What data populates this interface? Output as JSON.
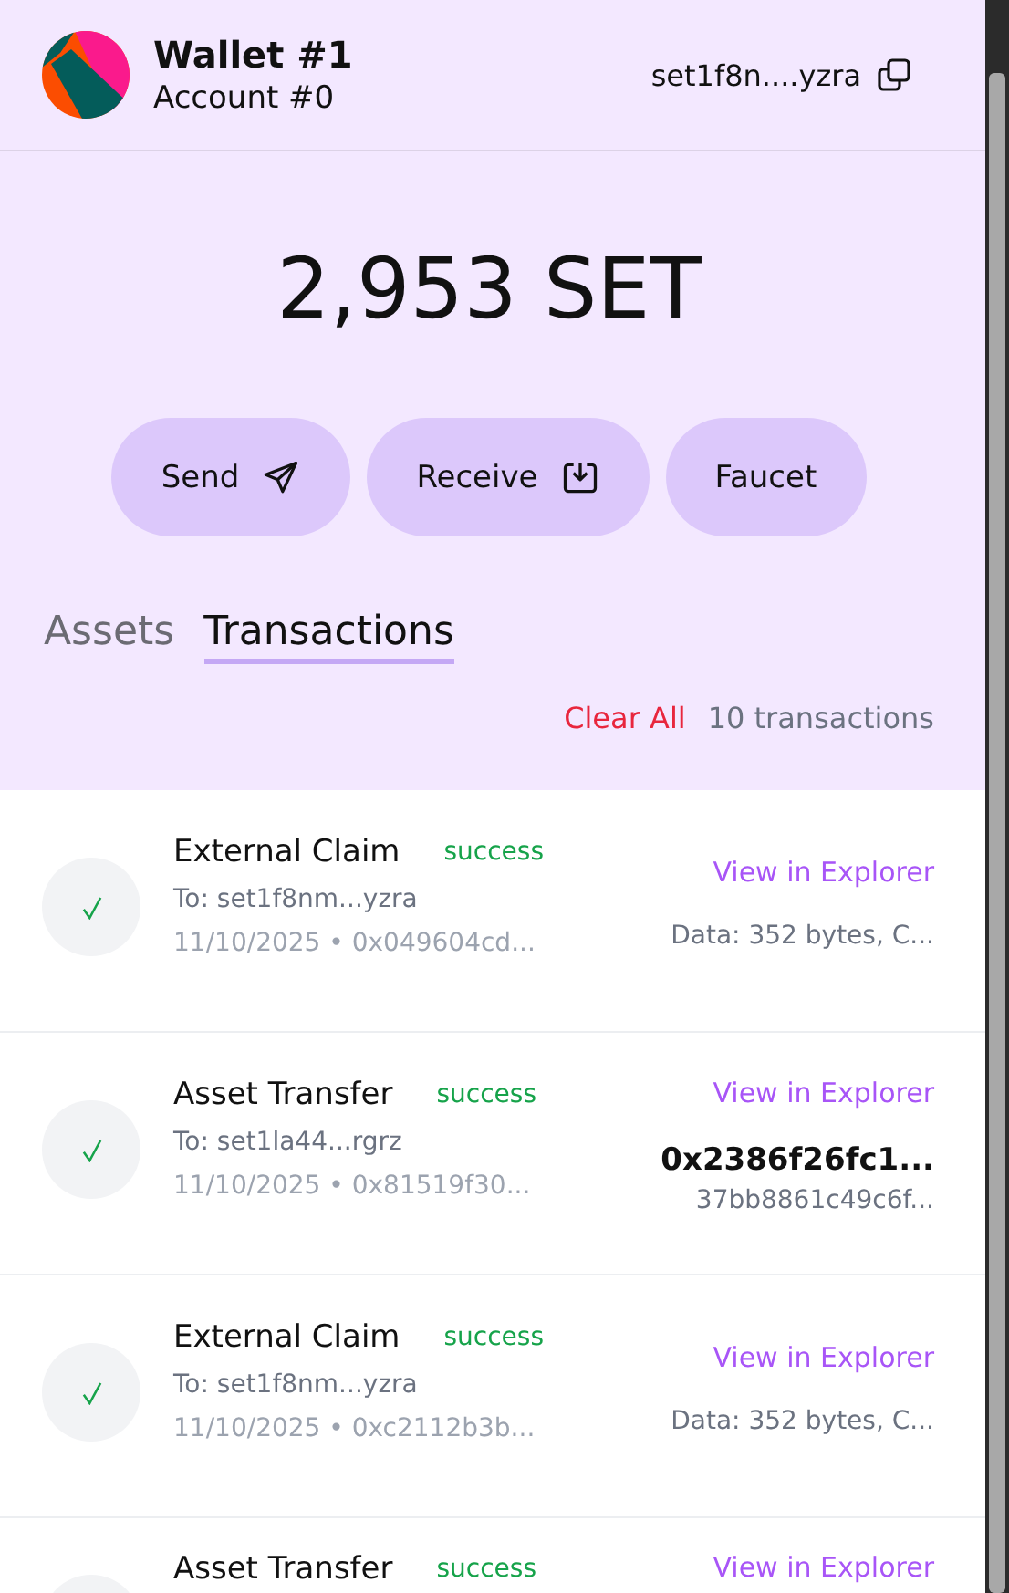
{
  "wallet": {
    "name": "Wallet #1",
    "account": "Account #0",
    "address": "set1f8n....yzra"
  },
  "balance": "2,953 SET",
  "actions": [
    {
      "label": "Send"
    },
    {
      "label": "Receive"
    },
    {
      "label": "Faucet"
    }
  ],
  "tabs": [
    {
      "label": "Assets",
      "selected": false
    },
    {
      "label": "Transactions",
      "selected": true
    }
  ],
  "clear_all": "Clear All",
  "count": "10 transactions",
  "transactions": [
    {
      "kind": "claim",
      "title": "External Claim",
      "status": "success",
      "to": "To: set1f8nm...yzra",
      "meta": "11/10/2025 • 0x049604cd...",
      "link": "View in Explorer",
      "detail": "Data: 352 bytes, C..."
    },
    {
      "kind": "transfer",
      "title": "Asset Transfer",
      "status": "success",
      "to": "To: set1la44...rgrz",
      "meta": "11/10/2025 • 0x81519f30...",
      "link": "View in Explorer",
      "amount": "0x2386f26fc1...",
      "detail": "37bb8861c49c6f..."
    },
    {
      "kind": "claim",
      "title": "External Claim",
      "status": "success",
      "to": "To: set1f8nm...yzra",
      "meta": "11/10/2025 • 0xc2112b3b...",
      "link": "View in Explorer",
      "detail": "Data: 352 bytes, C..."
    },
    {
      "kind": "transfer",
      "title": "Asset Transfer",
      "status": "success",
      "link": "View in Explorer"
    }
  ]
}
